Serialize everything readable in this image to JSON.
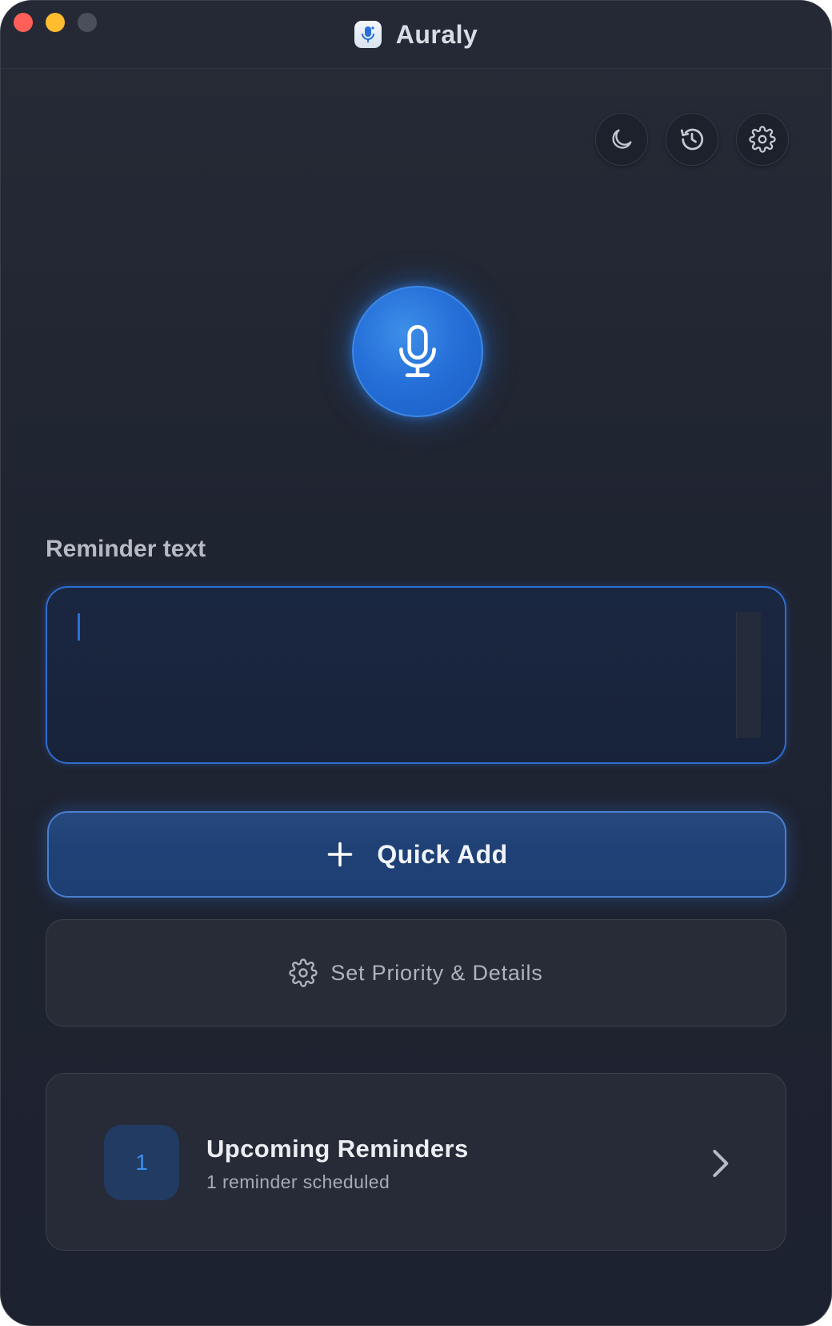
{
  "window": {
    "title": "Auraly"
  },
  "toolbar": {
    "theme_icon": "moon-icon",
    "history_icon": "history-icon",
    "settings_icon": "gear-icon"
  },
  "recorder": {
    "icon": "microphone-icon",
    "accent": "#2670d9"
  },
  "reminder": {
    "label": "Reminder text",
    "value": ""
  },
  "actions": {
    "quick_add_label": "Quick Add",
    "quick_add_icon": "plus-icon",
    "details_label": "Set Priority & Details",
    "details_icon": "gear-icon"
  },
  "upcoming": {
    "count": "1",
    "title": "Upcoming Reminders",
    "subtitle": "1 reminder scheduled",
    "chevron_icon": "chevron-right-icon"
  }
}
